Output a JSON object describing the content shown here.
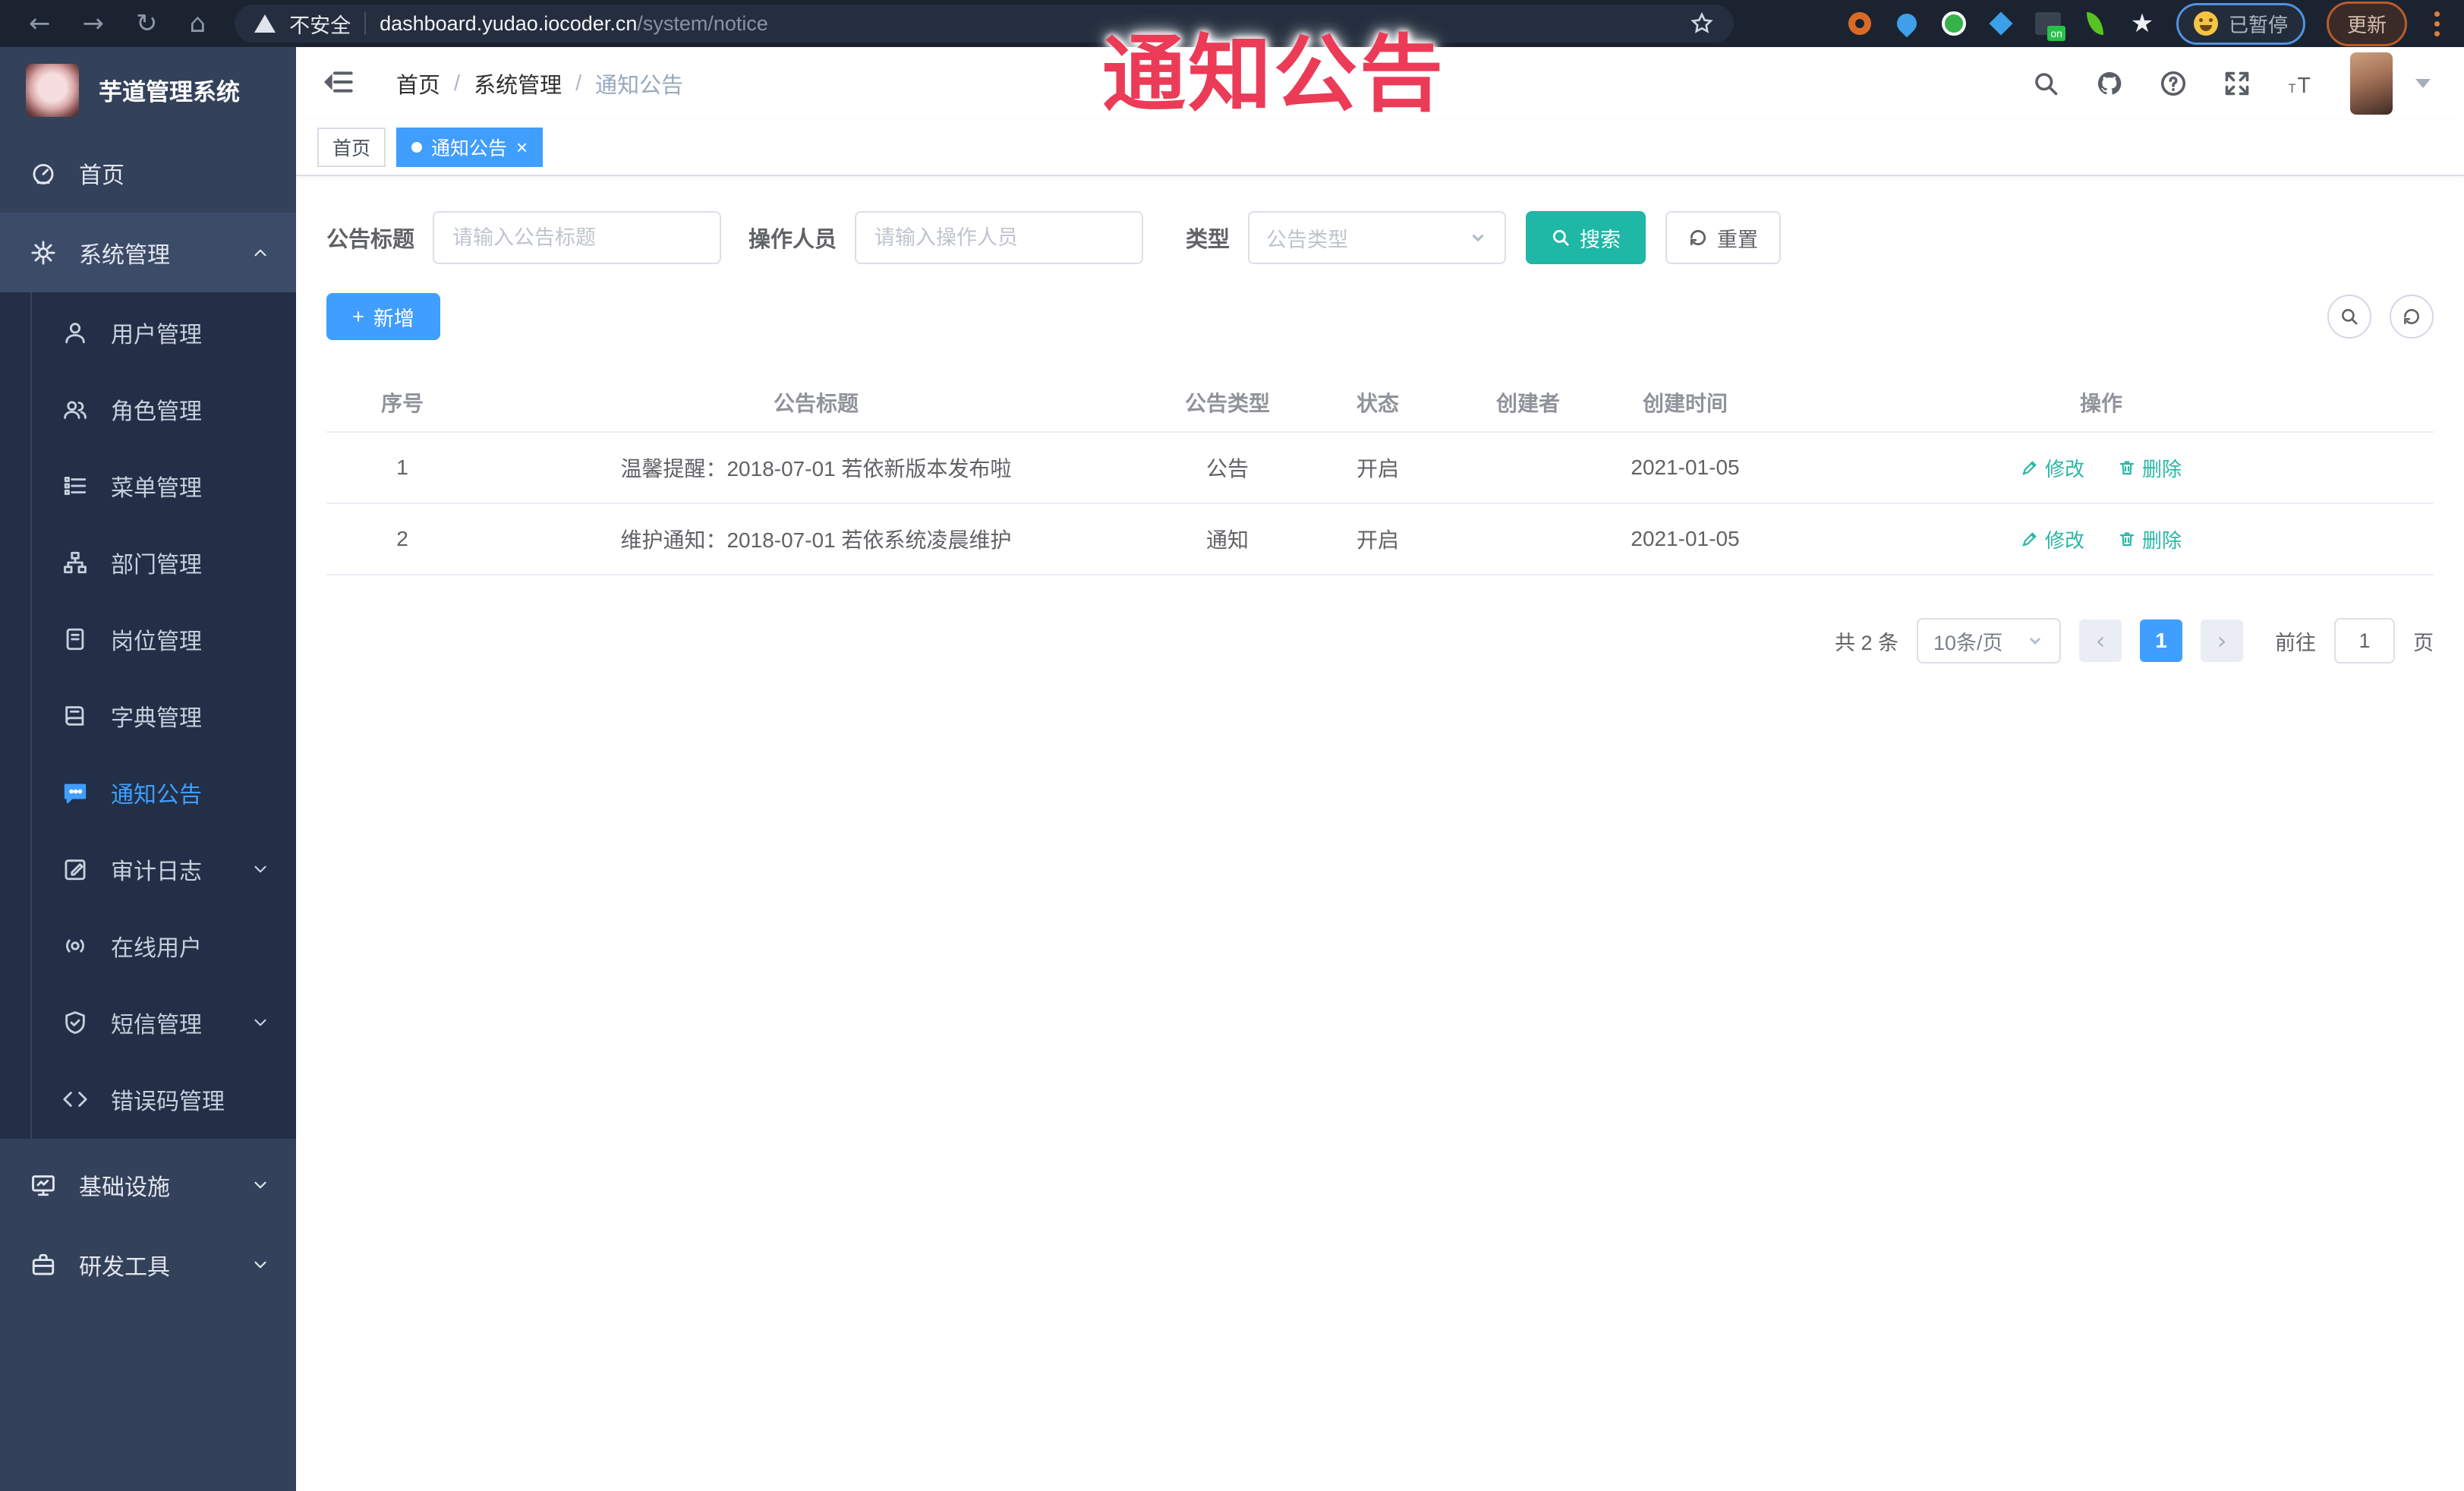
{
  "colors": {
    "accent": "#409eff",
    "teal": "#1fb7a6",
    "action_link": "#2ab7a5",
    "overlay_red": "#ec3b57",
    "sidebar_bg": "#33415a",
    "submenu_bg": "#222f46"
  },
  "browser": {
    "back": "←",
    "forward": "→",
    "reload": "↻",
    "home": "⌂",
    "security": "不安全",
    "url_domain": "dashboard.yudao.iocoder.cn",
    "url_path": "/system/notice",
    "on_badge": "on",
    "paused": "已暂停",
    "update": "更新"
  },
  "overlay": {
    "text": "通知公告"
  },
  "sidebar": {
    "title": "芋道管理系统",
    "home": "首页",
    "system": "系统管理",
    "submenu": [
      {
        "label": "用户管理"
      },
      {
        "label": "角色管理"
      },
      {
        "label": "菜单管理"
      },
      {
        "label": "部门管理"
      },
      {
        "label": "岗位管理"
      },
      {
        "label": "字典管理"
      },
      {
        "label": "通知公告"
      },
      {
        "label": "审计日志"
      },
      {
        "label": "在线用户"
      },
      {
        "label": "短信管理"
      },
      {
        "label": "错误码管理"
      }
    ],
    "bottom": [
      {
        "label": "基础设施"
      },
      {
        "label": "研发工具"
      }
    ]
  },
  "header": {
    "breadcrumb": [
      "首页",
      "系统管理",
      "通知公告"
    ],
    "separator": "/"
  },
  "tabs": {
    "home": "首页",
    "active": "通知公告",
    "close": "×"
  },
  "filters": {
    "title_label": "公告标题",
    "title_placeholder": "请输入公告标题",
    "operator_label": "操作人员",
    "operator_placeholder": "请输入操作人员",
    "type_label": "类型",
    "type_placeholder": "公告类型",
    "search": "搜索",
    "reset": "重置"
  },
  "toolbar": {
    "add": "新增",
    "plus": "+"
  },
  "table": {
    "columns": [
      "序号",
      "公告标题",
      "公告类型",
      "状态",
      "创建者",
      "创建时间",
      "操作"
    ],
    "rows": [
      {
        "no": "1",
        "title": "温馨提醒：2018-07-01 若依新版本发布啦",
        "type": "公告",
        "status": "开启",
        "creator": "",
        "created": "2021-01-05"
      },
      {
        "no": "2",
        "title": "维护通知：2018-07-01 若依系统凌晨维护",
        "type": "通知",
        "status": "开启",
        "creator": "",
        "created": "2021-01-05"
      }
    ],
    "edit": "修改",
    "delete": "删除"
  },
  "pagination": {
    "total": "共 2 条",
    "size": "10条/页",
    "prev": "‹",
    "next": "›",
    "page": "1",
    "goto": "前往",
    "goto_value": "1",
    "unit": "页"
  }
}
